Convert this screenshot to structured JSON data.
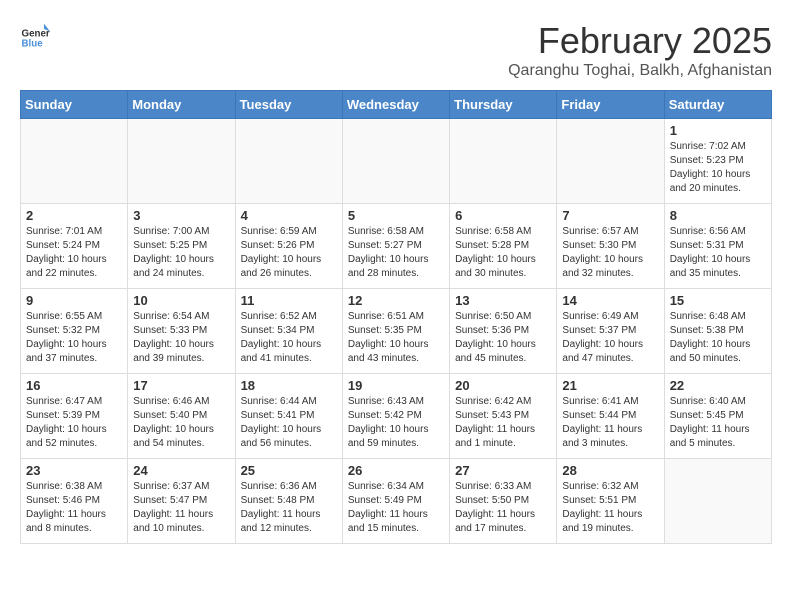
{
  "header": {
    "logo_general": "General",
    "logo_blue": "Blue",
    "month_year": "February 2025",
    "location": "Qaranghu Toghai, Balkh, Afghanistan"
  },
  "days_of_week": [
    "Sunday",
    "Monday",
    "Tuesday",
    "Wednesday",
    "Thursday",
    "Friday",
    "Saturday"
  ],
  "weeks": [
    [
      {
        "day": "",
        "info": ""
      },
      {
        "day": "",
        "info": ""
      },
      {
        "day": "",
        "info": ""
      },
      {
        "day": "",
        "info": ""
      },
      {
        "day": "",
        "info": ""
      },
      {
        "day": "",
        "info": ""
      },
      {
        "day": "1",
        "info": "Sunrise: 7:02 AM\nSunset: 5:23 PM\nDaylight: 10 hours and 20 minutes."
      }
    ],
    [
      {
        "day": "2",
        "info": "Sunrise: 7:01 AM\nSunset: 5:24 PM\nDaylight: 10 hours and 22 minutes."
      },
      {
        "day": "3",
        "info": "Sunrise: 7:00 AM\nSunset: 5:25 PM\nDaylight: 10 hours and 24 minutes."
      },
      {
        "day": "4",
        "info": "Sunrise: 6:59 AM\nSunset: 5:26 PM\nDaylight: 10 hours and 26 minutes."
      },
      {
        "day": "5",
        "info": "Sunrise: 6:58 AM\nSunset: 5:27 PM\nDaylight: 10 hours and 28 minutes."
      },
      {
        "day": "6",
        "info": "Sunrise: 6:58 AM\nSunset: 5:28 PM\nDaylight: 10 hours and 30 minutes."
      },
      {
        "day": "7",
        "info": "Sunrise: 6:57 AM\nSunset: 5:30 PM\nDaylight: 10 hours and 32 minutes."
      },
      {
        "day": "8",
        "info": "Sunrise: 6:56 AM\nSunset: 5:31 PM\nDaylight: 10 hours and 35 minutes."
      }
    ],
    [
      {
        "day": "9",
        "info": "Sunrise: 6:55 AM\nSunset: 5:32 PM\nDaylight: 10 hours and 37 minutes."
      },
      {
        "day": "10",
        "info": "Sunrise: 6:54 AM\nSunset: 5:33 PM\nDaylight: 10 hours and 39 minutes."
      },
      {
        "day": "11",
        "info": "Sunrise: 6:52 AM\nSunset: 5:34 PM\nDaylight: 10 hours and 41 minutes."
      },
      {
        "day": "12",
        "info": "Sunrise: 6:51 AM\nSunset: 5:35 PM\nDaylight: 10 hours and 43 minutes."
      },
      {
        "day": "13",
        "info": "Sunrise: 6:50 AM\nSunset: 5:36 PM\nDaylight: 10 hours and 45 minutes."
      },
      {
        "day": "14",
        "info": "Sunrise: 6:49 AM\nSunset: 5:37 PM\nDaylight: 10 hours and 47 minutes."
      },
      {
        "day": "15",
        "info": "Sunrise: 6:48 AM\nSunset: 5:38 PM\nDaylight: 10 hours and 50 minutes."
      }
    ],
    [
      {
        "day": "16",
        "info": "Sunrise: 6:47 AM\nSunset: 5:39 PM\nDaylight: 10 hours and 52 minutes."
      },
      {
        "day": "17",
        "info": "Sunrise: 6:46 AM\nSunset: 5:40 PM\nDaylight: 10 hours and 54 minutes."
      },
      {
        "day": "18",
        "info": "Sunrise: 6:44 AM\nSunset: 5:41 PM\nDaylight: 10 hours and 56 minutes."
      },
      {
        "day": "19",
        "info": "Sunrise: 6:43 AM\nSunset: 5:42 PM\nDaylight: 10 hours and 59 minutes."
      },
      {
        "day": "20",
        "info": "Sunrise: 6:42 AM\nSunset: 5:43 PM\nDaylight: 11 hours and 1 minute."
      },
      {
        "day": "21",
        "info": "Sunrise: 6:41 AM\nSunset: 5:44 PM\nDaylight: 11 hours and 3 minutes."
      },
      {
        "day": "22",
        "info": "Sunrise: 6:40 AM\nSunset: 5:45 PM\nDaylight: 11 hours and 5 minutes."
      }
    ],
    [
      {
        "day": "23",
        "info": "Sunrise: 6:38 AM\nSunset: 5:46 PM\nDaylight: 11 hours and 8 minutes."
      },
      {
        "day": "24",
        "info": "Sunrise: 6:37 AM\nSunset: 5:47 PM\nDaylight: 11 hours and 10 minutes."
      },
      {
        "day": "25",
        "info": "Sunrise: 6:36 AM\nSunset: 5:48 PM\nDaylight: 11 hours and 12 minutes."
      },
      {
        "day": "26",
        "info": "Sunrise: 6:34 AM\nSunset: 5:49 PM\nDaylight: 11 hours and 15 minutes."
      },
      {
        "day": "27",
        "info": "Sunrise: 6:33 AM\nSunset: 5:50 PM\nDaylight: 11 hours and 17 minutes."
      },
      {
        "day": "28",
        "info": "Sunrise: 6:32 AM\nSunset: 5:51 PM\nDaylight: 11 hours and 19 minutes."
      },
      {
        "day": "",
        "info": ""
      }
    ]
  ]
}
